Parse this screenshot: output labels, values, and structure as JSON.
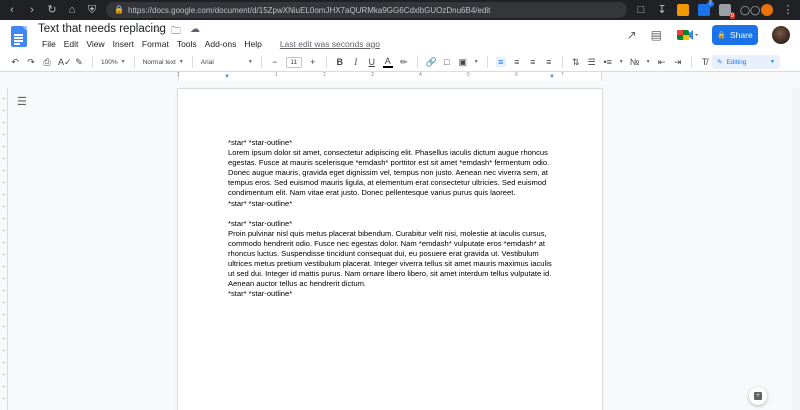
{
  "browser": {
    "url": "https://docs.google.com/document/d/15ZpwXNiuEL0omJHX7aQURMka9GG6CdxlbGUOzDnu6B4/edit",
    "extensions": [
      {
        "name": "vimium-icon",
        "color": "#f29900"
      },
      {
        "name": "extension-blue-icon",
        "color": "#1a73e8",
        "badge": "7"
      },
      {
        "name": "extension-gray-icon",
        "color": "#9aa0a6",
        "badge": "9"
      },
      {
        "name": "glasses-icon",
        "color": "#9aa0a6"
      },
      {
        "name": "extension-orange-icon",
        "color": "#e8710a"
      }
    ]
  },
  "docs": {
    "title": "Text that needs replacing",
    "menu": [
      "File",
      "Edit",
      "View",
      "Insert",
      "Format",
      "Tools",
      "Add-ons",
      "Help"
    ],
    "last_edit": "Last edit was seconds ago",
    "share_label": "Share"
  },
  "toolbar": {
    "zoom": "100%",
    "style": "Normal text",
    "font": "Arial",
    "font_size": "11",
    "mode": "Editing"
  },
  "ruler": {
    "numbers": [
      "1",
      "1",
      "2",
      "3",
      "4",
      "5",
      "6",
      "7"
    ]
  },
  "document": {
    "paragraphs": [
      "*star* *star-outline*",
      "Lorem ipsum dolor sit amet, consectetur adipiscing elit. Phasellus iaculis dictum augue rhoncus egestas. Fusce at mauris scelerisque *emdash* porttitor est sit amet *emdash* fermentum odio. Donec augue mauris, gravida eget dignissim vel, tempus non justo. Aenean nec viverra sem, at tempus eros. Sed euismod mauris ligula, at elementum erat consectetur ultricies. Sed euismod condimentum elit. Nam vitae erat justo. Donec pellentesque varius purus quis laoreet.",
      "*star* *star-outline*",
      "",
      "*star* *star-outline*",
      "Proin pulvinar nisl quis metus placerat bibendum. Curabitur velit nisi, molestie at iaculis cursus, commodo hendrerit odio. Fusce nec egestas dolor. Nam *emdash* vulputate eros *emdash* at rhoncus luctus. Suspendisse tincidunt consequat dui, eu posuere erat gravida ut. Vestibulum ultrices metus pretium vestibulum placerat. Integer viverra tellus sit amet mauris maximus iaculis ut sed dui. Integer id mattis purus. Nam ornare libero libero, sit amet interdum tellus vulputate id. Aenean auctor tellus ac hendrerit dictum.",
      "*star* *star-outline*"
    ]
  },
  "colors": {
    "accent": "#1a73e8",
    "browser_bg": "#202124",
    "docs_logo": "#4285f4"
  }
}
